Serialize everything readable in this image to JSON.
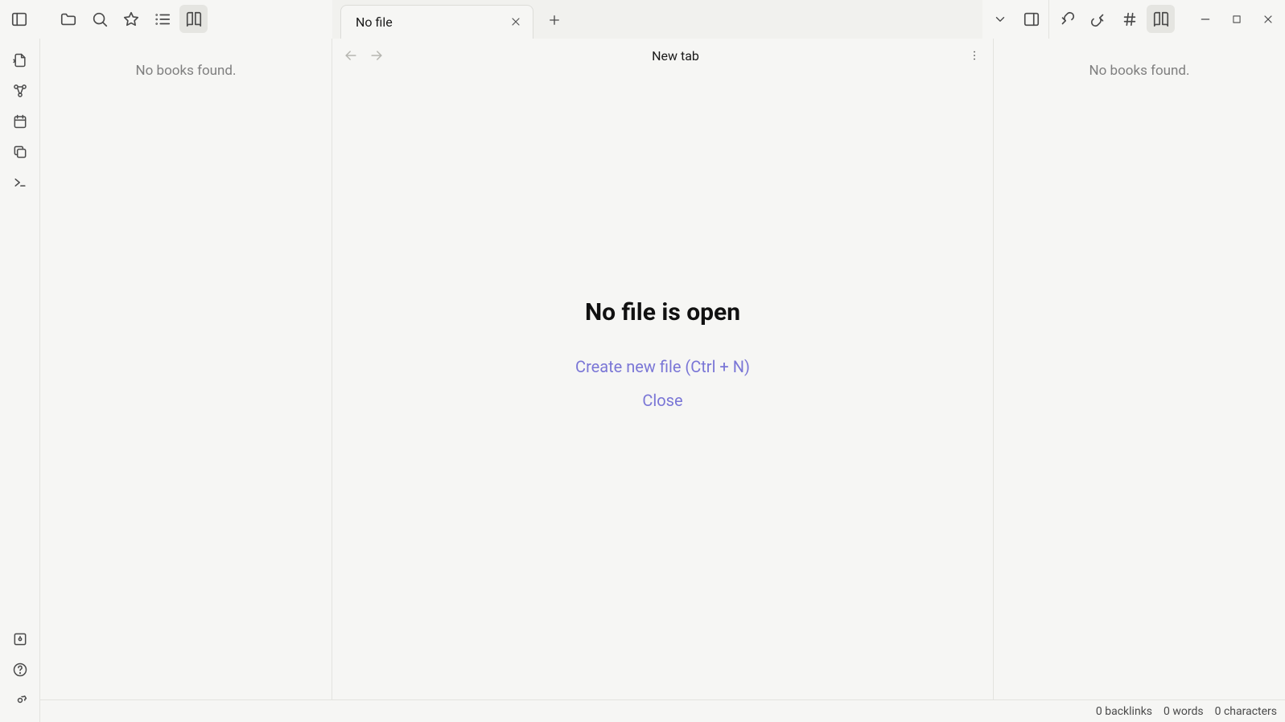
{
  "window_controls": {
    "minimize": "−",
    "maximize": "□",
    "close": "×"
  },
  "top_left_tools": {
    "collapse_left": "collapse-left",
    "files": "files",
    "search": "search",
    "bookmarks": "bookmarks",
    "outline": "outline",
    "books": "books"
  },
  "top_right_tools": {
    "tab_dropdown": "tab-dropdown",
    "collapse_right": "collapse-right",
    "link_in": "incoming-links",
    "link_out": "outgoing-links",
    "tags": "tags",
    "books": "books"
  },
  "tab": {
    "title": "No file"
  },
  "center": {
    "title": "New tab",
    "heading": "No file is open",
    "create_link": "Create new file (Ctrl + N)",
    "close_link": "Close"
  },
  "left_panel": {
    "empty": "No books found."
  },
  "right_panel": {
    "empty": "No books found."
  },
  "status": {
    "backlinks": "0 backlinks",
    "words": "0 words",
    "characters": "0 characters"
  }
}
